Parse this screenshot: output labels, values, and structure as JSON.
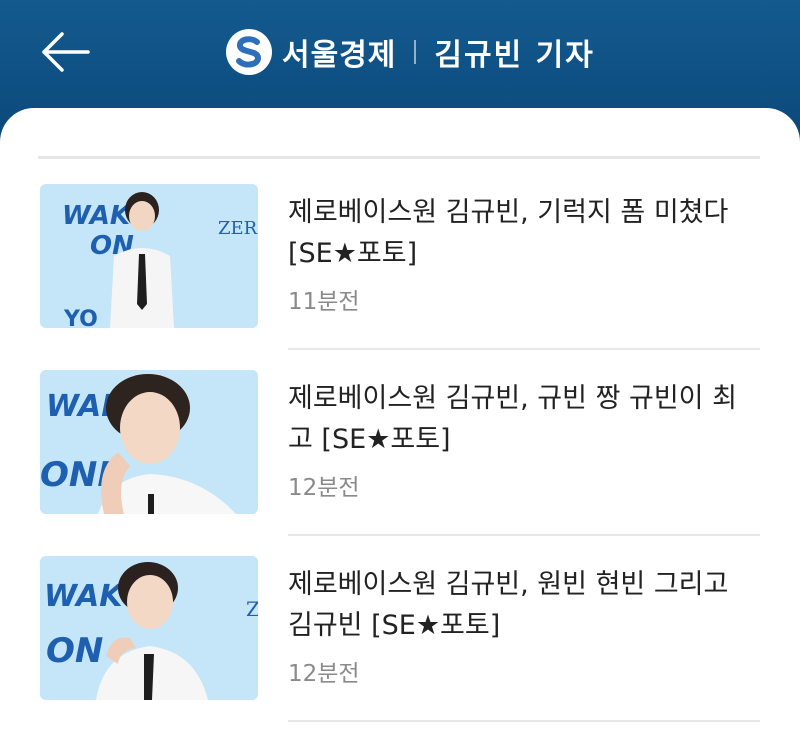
{
  "header": {
    "brand": "서울경제",
    "reporter": "김규빈 기자",
    "colors": {
      "bar": "#0e4f82",
      "logo_accent": "#2d6fb8"
    }
  },
  "articles": [
    {
      "title": "제로베이스원 김규빈, 기럭지 폼 미쳤다 [SE★포토]",
      "time": "11분전",
      "thumb_text": [
        "WAK",
        "ON",
        "YO",
        "ZER"
      ]
    },
    {
      "title": "제로베이스원 김규빈, 규빈 짱 규빈이 최고 [SE★포토]",
      "time": "12분전",
      "thumb_text": [
        "WAK",
        "ONE"
      ]
    },
    {
      "title": "제로베이스원 김규빈, 원빈 현빈 그리고 김규빈 [SE★포토]",
      "time": "12분전",
      "thumb_text": [
        "WAK",
        "ON",
        "Z"
      ]
    }
  ]
}
